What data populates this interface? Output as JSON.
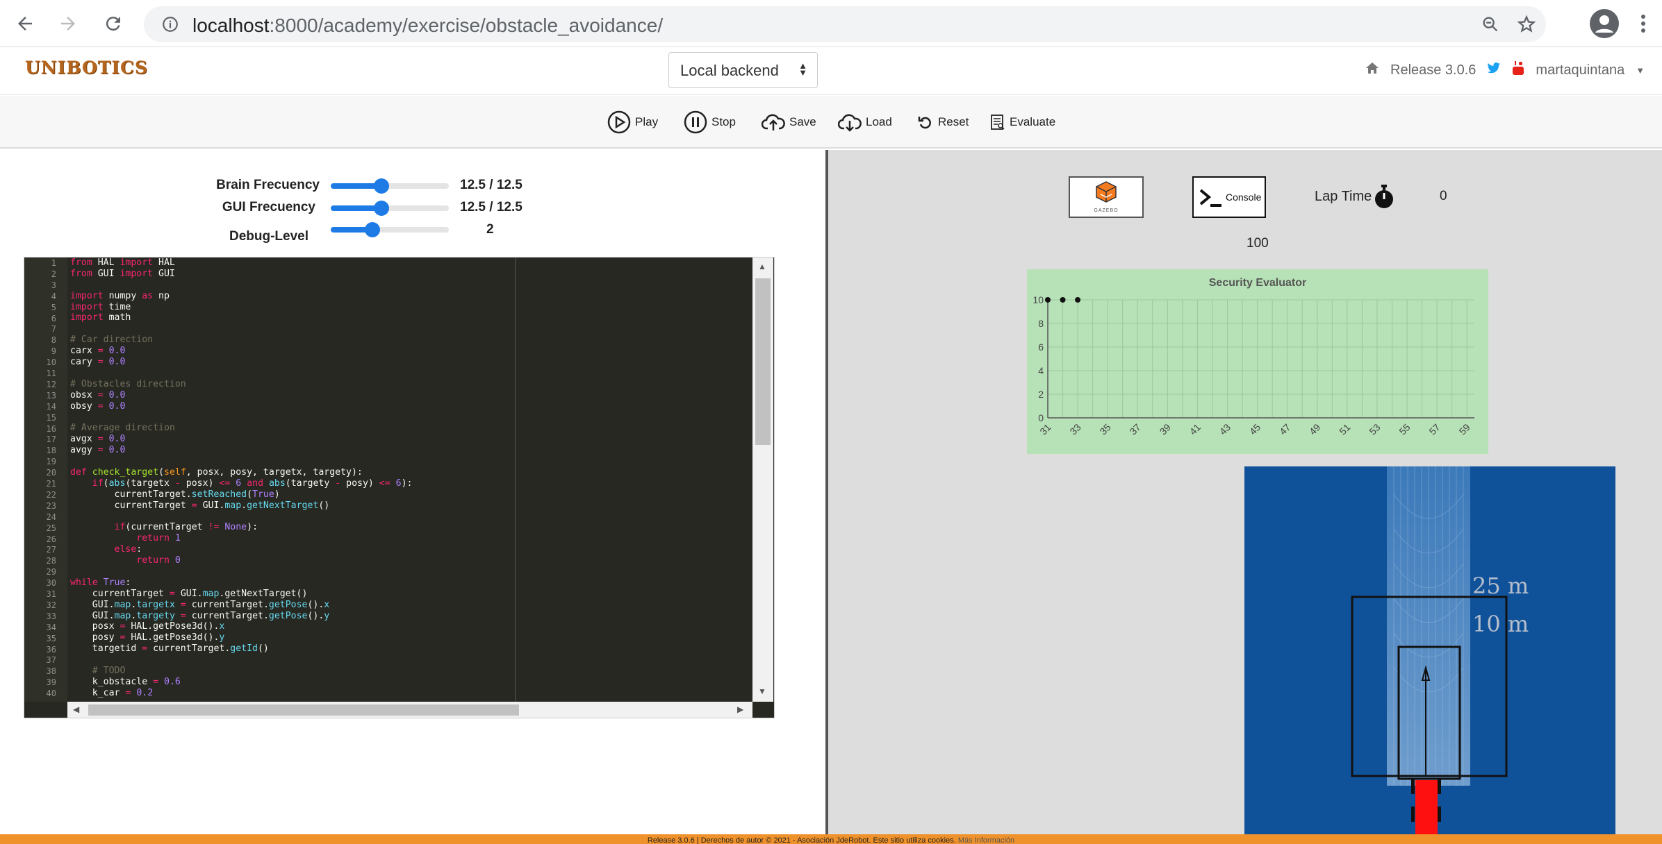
{
  "browser": {
    "url_host": "localhost",
    "url_path": ":8000/academy/exercise/obstacle_avoidance/"
  },
  "header": {
    "logo": "UNIBOTICS",
    "backend_select": "Local backend",
    "release": "Release 3.0.6",
    "username": "martaquintana"
  },
  "toolbar": {
    "play": "Play",
    "stop": "Stop",
    "save": "Save",
    "load": "Load",
    "reset": "Reset",
    "evaluate": "Evaluate"
  },
  "controls": {
    "brain_label": "Brain Frecuency",
    "brain_value": "12.5 / 12.5",
    "brain_level": 0.43,
    "gui_label": "GUI Frecuency",
    "gui_value": "12.5 / 12.5",
    "gui_level": 0.43,
    "debug_label": "Debug-Level",
    "debug_value": "2",
    "debug_level": 0.35
  },
  "code_lines": [
    "1",
    "2",
    "3",
    "4",
    "5",
    "6",
    "7",
    "8",
    "9",
    "10",
    "11",
    "12",
    "13",
    "14",
    "15",
    "16",
    "17",
    "18",
    "19",
    "20",
    "21",
    "22",
    "23",
    "24",
    "25",
    "26",
    "27",
    "28",
    "29",
    "30",
    "31",
    "32",
    "33",
    "34",
    "35",
    "36",
    "37",
    "38",
    "39",
    "40"
  ],
  "right": {
    "gazebo_label": "GAZEBO",
    "console_label": "Console",
    "laptime_label": "Lap Time",
    "laptime_value": "0",
    "score": "100",
    "sim_label_25": "25 m",
    "sim_label_10": "10 m"
  },
  "chart_data": {
    "type": "scatter",
    "title": "Security Evaluator",
    "x": [
      31,
      32,
      33
    ],
    "y": [
      10,
      10,
      10
    ],
    "xlim": [
      31,
      59.5
    ],
    "ylim": [
      0,
      10
    ],
    "xticks": [
      31,
      33,
      35,
      37,
      39,
      41,
      43,
      45,
      47,
      49,
      51,
      53,
      55,
      57,
      59
    ],
    "yticks": [
      0,
      2,
      4,
      6,
      8,
      10
    ],
    "grid": true,
    "bg_color": "#b7e1b7"
  },
  "footer": {
    "text": "Release 3.0.6 | Derechos de autor © 2021 - Asociación JdeRobot. Este sitio utiliza cookies.",
    "link": "Más Información"
  },
  "colors": {
    "accent": "#1e7be6",
    "footer": "#f0922b",
    "sim_bg": "#10529a"
  }
}
